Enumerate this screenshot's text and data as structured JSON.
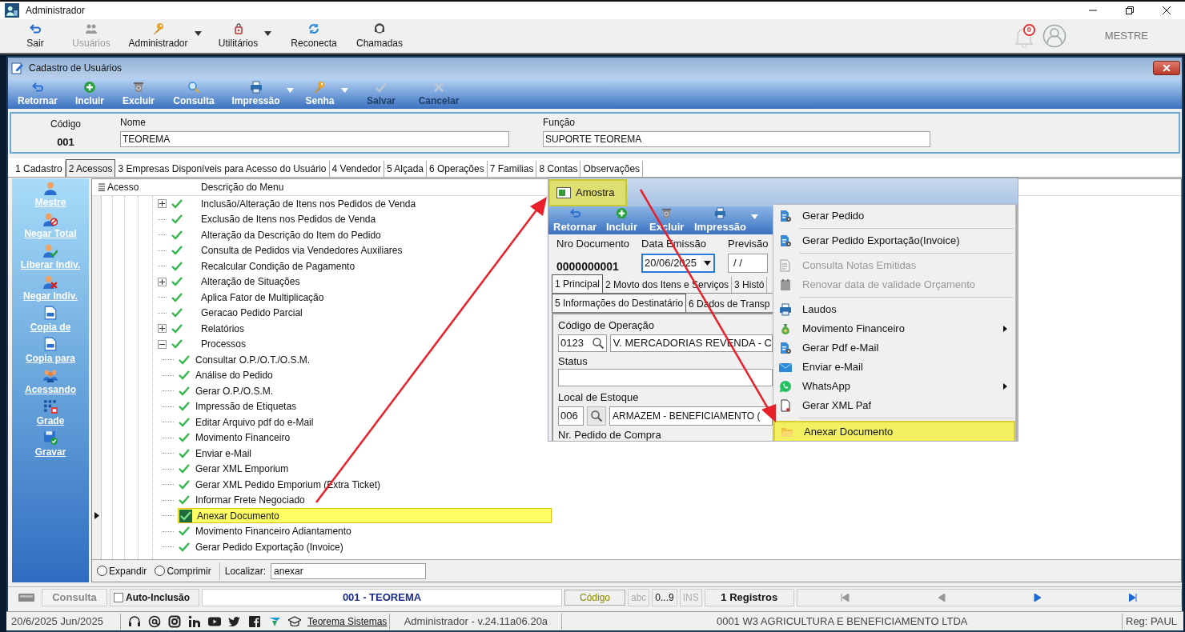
{
  "app_title": "Administrador",
  "main_toolbar": [
    {
      "label": "Sair",
      "disabled": false,
      "dropdown": false
    },
    {
      "label": "Usuários",
      "disabled": true,
      "dropdown": false
    },
    {
      "label": "Administrador",
      "disabled": false,
      "dropdown": true
    },
    {
      "label": "Utilitários",
      "disabled": false,
      "dropdown": true
    },
    {
      "label": "Reconecta",
      "disabled": false,
      "dropdown": false
    },
    {
      "label": "Chamadas",
      "disabled": false,
      "dropdown": false
    }
  ],
  "notifications": {
    "count": "0"
  },
  "user_name": "MESTRE",
  "form_window": {
    "title": "Cadastro de Usuários",
    "toolbar": [
      {
        "label": "Retornar",
        "disabled": false,
        "dropdown": false
      },
      {
        "label": "Incluir",
        "disabled": false,
        "dropdown": false
      },
      {
        "label": "Excluir",
        "disabled": false,
        "dropdown": false
      },
      {
        "label": "Consulta",
        "disabled": false,
        "dropdown": false
      },
      {
        "label": "Impressão",
        "disabled": false,
        "dropdown": true
      },
      {
        "label": "Senha",
        "disabled": false,
        "dropdown": true
      },
      {
        "label": "Salvar",
        "disabled": true,
        "dropdown": false
      },
      {
        "label": "Cancelar",
        "disabled": true,
        "dropdown": false
      }
    ]
  },
  "fields": {
    "codigo_label": "Código",
    "codigo": "001",
    "nome_label": "Nome",
    "nome": "TEOREMA",
    "funcao_label": "Função",
    "funcao": "SUPORTE TEOREMA"
  },
  "tabs": [
    {
      "label": "1 Cadastro",
      "selected": false
    },
    {
      "label": "2 Acessos",
      "selected": true
    },
    {
      "label": "3 Empresas Disponíveis para Acesso do Usuário",
      "selected": false
    },
    {
      "label": "4 Vendedor",
      "selected": false
    },
    {
      "label": "5 Alçada",
      "selected": false
    },
    {
      "label": "6 Operações",
      "selected": false
    },
    {
      "label": "7 Familias",
      "selected": false
    },
    {
      "label": "8 Contas",
      "selected": false
    },
    {
      "label": "Observações",
      "selected": false
    }
  ],
  "side_actions": [
    {
      "label": "Mestre"
    },
    {
      "label": "Negar Total"
    },
    {
      "label": "Liberar Indiv."
    },
    {
      "label": "Negar Indiv."
    },
    {
      "label": "Copia de"
    },
    {
      "label": "Copia para"
    },
    {
      "label": "Acessando"
    },
    {
      "label": "Grade"
    },
    {
      "label": "Gravar"
    }
  ],
  "tree": {
    "columns": [
      "Acesso",
      "Descrição do Menu"
    ],
    "items": [
      {
        "label": "Inclusão/Alteração de Itens nos Pedidos de Venda",
        "kind": "folder",
        "expanded": false,
        "checked": true,
        "selected": false
      },
      {
        "label": "Exclusão de Itens nos Pedidos de Venda",
        "kind": "item",
        "checked": true,
        "selected": false
      },
      {
        "label": "Alteração da Descrição do Item do Pedido",
        "kind": "item",
        "checked": true,
        "selected": false
      },
      {
        "label": "Consulta de Pedidos via Vendedores Auxiliares",
        "kind": "item",
        "checked": true,
        "selected": false
      },
      {
        "label": "Recalcular Condição de Pagamento",
        "kind": "item",
        "checked": true,
        "selected": false
      },
      {
        "label": "Alteração de Situações",
        "kind": "folder",
        "expanded": false,
        "checked": true,
        "selected": false
      },
      {
        "label": "Aplica Fator de Multiplicação",
        "kind": "item",
        "checked": true,
        "selected": false
      },
      {
        "label": "Geracao Pedido Parcial",
        "kind": "item",
        "checked": true,
        "selected": false
      },
      {
        "label": "Relatórios",
        "kind": "folder",
        "expanded": false,
        "checked": true,
        "selected": false
      },
      {
        "label": "Processos",
        "kind": "folder",
        "expanded": true,
        "checked": true,
        "selected": false,
        "children": [
          {
            "label": "Consultar O.P./O.T./O.S.M.",
            "kind": "item",
            "checked": true,
            "selected": false
          },
          {
            "label": "Análise do Pedido",
            "kind": "item",
            "checked": true,
            "selected": false
          },
          {
            "label": "Gerar O.P./O.S.M.",
            "kind": "item",
            "checked": true,
            "selected": false
          },
          {
            "label": "Impressão de Etiquetas",
            "kind": "item",
            "checked": true,
            "selected": false
          },
          {
            "label": "Editar Arquivo pdf do e-Mail",
            "kind": "item",
            "checked": true,
            "selected": false
          },
          {
            "label": "Movimento Financeiro",
            "kind": "item",
            "checked": true,
            "selected": false
          },
          {
            "label": "Enviar e-Mail",
            "kind": "item",
            "checked": true,
            "selected": false
          },
          {
            "label": "Gerar XML Emporium",
            "kind": "item",
            "checked": true,
            "selected": false
          },
          {
            "label": "Gerar XML Pedido Emporium (Extra Ticket)",
            "kind": "item",
            "checked": true,
            "selected": false
          },
          {
            "label": "Informar Frete Negociado",
            "kind": "item",
            "checked": true,
            "selected": false
          },
          {
            "label": "Anexar Documento",
            "kind": "item",
            "checked": true,
            "selected": true
          },
          {
            "label": "Movimento Financeiro Adiantamento",
            "kind": "item",
            "checked": true,
            "selected": false
          },
          {
            "label": "Gerar Pedido Exportação (Invoice)",
            "kind": "item",
            "checked": true,
            "selected": false
          }
        ]
      }
    ]
  },
  "tree_footer": {
    "options": [
      {
        "label": "Expandir",
        "selected": false
      },
      {
        "label": "Comprimir",
        "selected": false
      }
    ],
    "search_label": "Localizar:",
    "search_value": "anexar"
  },
  "record_bar": {
    "mode": "Consulta",
    "auto_inclusao": {
      "label": "Auto-Inclusão",
      "checked": false
    },
    "record": "001 - TEOREMA",
    "order": "Código",
    "flags": [
      {
        "label": "abc",
        "active": false
      },
      {
        "label": "0...9",
        "active": true
      },
      {
        "label": "INS",
        "active": false
      }
    ],
    "count": "1 Registros",
    "nav": [
      {
        "enabled": false
      },
      {
        "enabled": false
      },
      {
        "enabled": true
      },
      {
        "enabled": true
      }
    ]
  },
  "status_bar": {
    "date": "20/6/2025 Jun/2025",
    "link": "Teorema Sistemas",
    "version": "Administrador - v.24.11a06.20a",
    "company": "0001 W3 AGRICULTURA E BENEFICIAMENTO LTDA",
    "reg": "Reg: PAUL"
  },
  "inset": {
    "title": "Amostra",
    "toolbar": [
      {
        "label": "Retornar",
        "dropdown": false
      },
      {
        "label": "Incluir",
        "dropdown": false
      },
      {
        "label": "Excluir",
        "dropdown": false
      },
      {
        "label": "Impressão",
        "dropdown": true
      }
    ],
    "doc_label": "Nro Documento",
    "doc": "0000000001",
    "date_label": "Data Emissão",
    "date": "20/06/2025",
    "prev_label": "Previsão",
    "prev": "/ /",
    "tabs1": [
      {
        "label": "1 Principal",
        "selected": true
      },
      {
        "label": "2 Movto dos Itens e Serviços",
        "selected": false
      },
      {
        "label": "3 Histó",
        "selected": false
      }
    ],
    "tabs2": [
      {
        "label": "5 Informações do Destinatário",
        "selected": true
      },
      {
        "label": "6 Dados de Transp",
        "selected": false
      }
    ],
    "op_label": "Código de Operação",
    "op_code": "0123",
    "op_name": "V. MERCADORIAS REVENDA - C",
    "status_label": "Status",
    "stock_label": "Local de Estoque",
    "stock_code": "006",
    "stock_name": "ARMAZEM - BENEFICIAMENTO (",
    "po_label": "Nr. Pedido de Compra"
  },
  "context_menu": [
    {
      "label": "Gerar Pedido",
      "disabled": false,
      "submenu": false,
      "highlighted": false,
      "separator_after": true
    },
    {
      "label": "Gerar Pedido Exportação(Invoice)",
      "disabled": false,
      "submenu": false,
      "highlighted": false,
      "separator_after": true
    },
    {
      "label": "Consulta Notas Emitidas",
      "disabled": true,
      "submenu": false,
      "highlighted": false,
      "separator_after": false
    },
    {
      "label": "Renovar data de validade Orçamento",
      "disabled": true,
      "submenu": false,
      "highlighted": false,
      "separator_after": true
    },
    {
      "label": "Laudos",
      "disabled": false,
      "submenu": false,
      "highlighted": false,
      "separator_after": false
    },
    {
      "label": "Movimento Financeiro",
      "disabled": false,
      "submenu": true,
      "highlighted": false,
      "separator_after": false
    },
    {
      "label": "Gerar Pdf e-Mail",
      "disabled": false,
      "submenu": false,
      "highlighted": false,
      "separator_after": false
    },
    {
      "label": "Enviar e-Mail",
      "disabled": false,
      "submenu": false,
      "highlighted": false,
      "separator_after": false
    },
    {
      "label": "WhatsApp",
      "disabled": false,
      "submenu": true,
      "highlighted": false,
      "separator_after": false
    },
    {
      "label": "Gerar XML Paf",
      "disabled": false,
      "submenu": false,
      "highlighted": false,
      "separator_after": true
    },
    {
      "label": "Anexar Documento",
      "disabled": false,
      "submenu": false,
      "highlighted": true,
      "separator_after": false
    }
  ]
}
